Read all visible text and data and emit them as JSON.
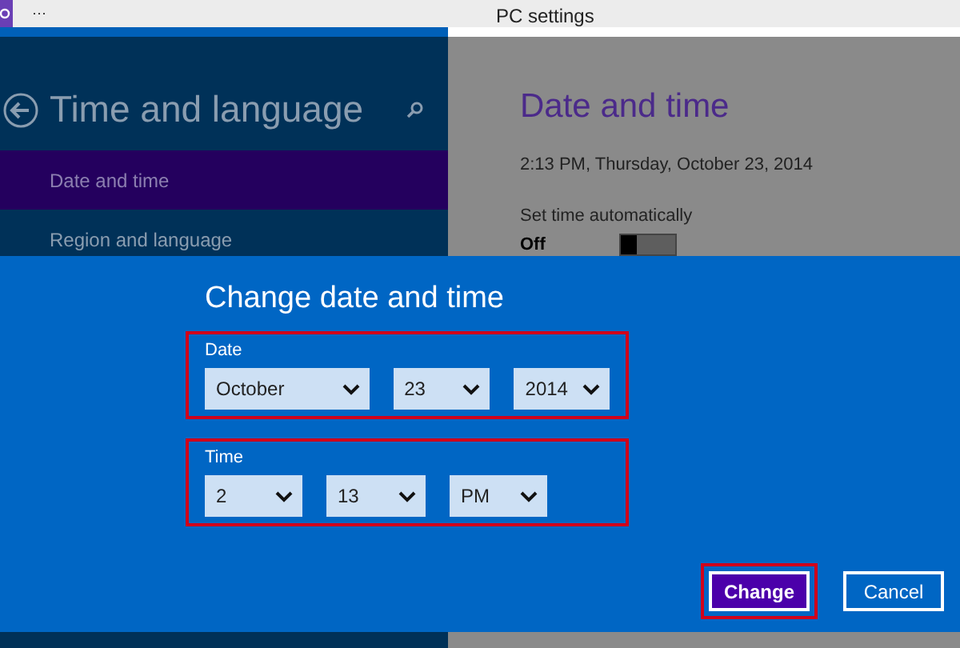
{
  "window": {
    "title": "PC settings",
    "menu_glyph": "···"
  },
  "sidebar": {
    "title": "Time and language",
    "items": [
      {
        "label": "Date and time",
        "selected": true
      },
      {
        "label": "Region and language",
        "selected": false
      }
    ]
  },
  "content": {
    "heading": "Date and time",
    "current": "2:13 PM, Thursday, October 23, 2014",
    "auto_label": "Set time automatically",
    "auto_state": "Off",
    "auto_on": false
  },
  "dialog": {
    "title": "Change date and time",
    "groups": [
      {
        "label": "Date",
        "highlighted": true,
        "fields": [
          {
            "value": "October"
          },
          {
            "value": "23"
          },
          {
            "value": "2014"
          }
        ]
      },
      {
        "label": "Time",
        "highlighted": true,
        "fields": [
          {
            "value": "2"
          },
          {
            "value": "13"
          },
          {
            "value": "PM"
          }
        ]
      }
    ],
    "buttons": [
      {
        "label": "Change",
        "kind": "primary",
        "highlighted": true
      },
      {
        "label": "Cancel",
        "kind": "secondary",
        "highlighted": false
      }
    ]
  }
}
